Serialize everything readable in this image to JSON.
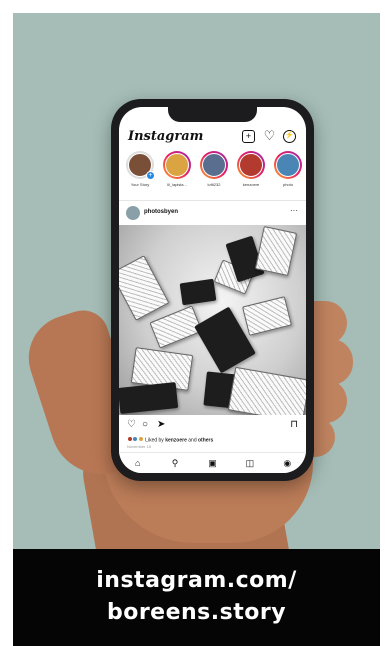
{
  "app": {
    "logo_text": "Instagram",
    "header_icons": [
      "add-post-icon",
      "heart-icon",
      "messenger-icon"
    ]
  },
  "stories": [
    {
      "label": "Your Story",
      "has_add": true,
      "avatar_color": "#7a4f38"
    },
    {
      "label": "lil_lapisla...",
      "has_add": false,
      "avatar_color": "#d9a441"
    },
    {
      "label": "lofti232",
      "has_add": false,
      "avatar_color": "#5a6f8f"
    },
    {
      "label": "kenzoere",
      "has_add": false,
      "avatar_color": "#b33a2e"
    },
    {
      "label": "photo",
      "has_add": false,
      "avatar_color": "#4a86b5"
    }
  ],
  "post": {
    "username": "photosbyen",
    "more_label": "···",
    "likes_prefix": "Liked by ",
    "likes_user": "kenzoere",
    "likes_and": " and ",
    "likes_others": "others",
    "date": "November 15"
  },
  "tabbar": {
    "items": [
      "home-icon",
      "search-icon",
      "reels-icon",
      "shop-icon",
      "profile-icon"
    ]
  },
  "caption": {
    "line1": "instagram.com/",
    "line2": "boreens.story"
  },
  "colors": {
    "background": "#a5bdb6",
    "caption_bg": "#050505",
    "story_gradient": [
      "#f9a825",
      "#e91e63",
      "#9c27b0"
    ],
    "add_badge": "#1e88e5"
  }
}
